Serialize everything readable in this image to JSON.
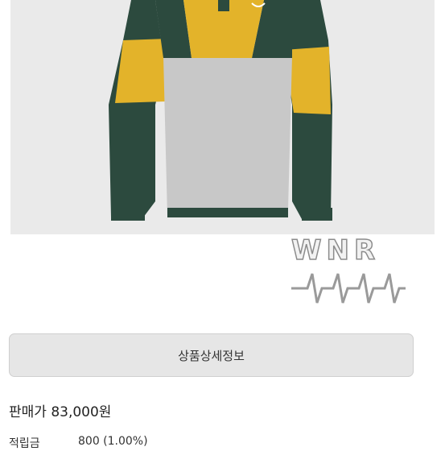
{
  "product": {
    "image": "rugby-shirt-photo",
    "colors": {
      "green": "#2c4a3e",
      "yellow": "#e3b32a",
      "gray": "#c8c8c8",
      "background": "#eaeaea"
    }
  },
  "watermark": {
    "brand": "WNR",
    "icon": "heartbeat-line-icon"
  },
  "detail_button": {
    "label": "상품상세정보"
  },
  "price": {
    "label": "판매가",
    "value": "83,000원"
  },
  "points": {
    "label": "적립금",
    "value": "800 (1.00%)"
  }
}
